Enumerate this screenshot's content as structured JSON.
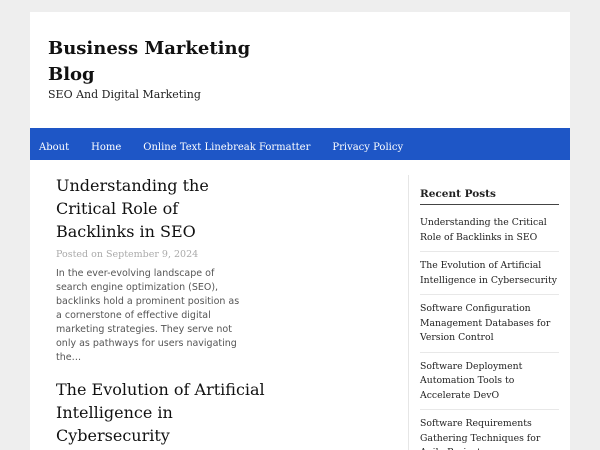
{
  "site": {
    "title": "Business Marketing Blog",
    "tagline": "SEO And Digital Marketing"
  },
  "nav": {
    "items": [
      {
        "label": "About"
      },
      {
        "label": "Home"
      },
      {
        "label": "Online Text Linebreak Formatter"
      },
      {
        "label": "Privacy Policy"
      }
    ]
  },
  "posts": [
    {
      "title": "Understanding the Critical Role of Backlinks in SEO",
      "meta": "Posted on September 9, 2024",
      "excerpt": "In the ever-evolving landscape of search engine optimization (SEO), backlinks hold a prominent position as a cornerstone of effective digital marketing strategies. They serve not only as pathways for users navigating the…"
    },
    {
      "title": "The Evolution of Artificial Intelligence in Cybersecurity"
    }
  ],
  "sidebar": {
    "widget_title": "Recent Posts",
    "items": [
      {
        "label": "Understanding the Critical Role of Backlinks in SEO"
      },
      {
        "label": "The Evolution of Artificial Intelligence in Cybersecurity"
      },
      {
        "label": "Software Configuration Management Databases for Version Control"
      },
      {
        "label": "Software Deployment Automation Tools to Accelerate DevO"
      },
      {
        "label": "Software Requirements Gathering Techniques for Agile Projects"
      }
    ]
  },
  "colors": {
    "nav_background": "#1e56c6",
    "page_background": "#eeeeee",
    "content_background": "#ffffff"
  }
}
